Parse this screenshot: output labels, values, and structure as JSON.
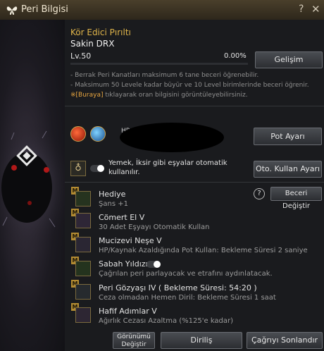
{
  "window": {
    "title": "Peri Bilgisi",
    "help_glyph": "?",
    "close_glyph": "✕"
  },
  "pet": {
    "name_line": "Kör Edici Pırıltı",
    "type_line": "Sakin DRX",
    "level": "Lv.50",
    "exp": "0.00%",
    "upgrade_button": "Gelişim"
  },
  "info": {
    "line1": "- Berrak Peri Kanatları maksimum 6 tane beceri öğrenebilir.",
    "line2": "- Maksimum 50 Levele kadar büyür ve 10 Level birimlerinde beceri öğrenir.",
    "line3_link": "[Buraya]",
    "line3_rest": " tıklayarak oran bilgisini görüntüleyebilirsiniz."
  },
  "potion": {
    "hp_label": "HP",
    "pot_button": "Pot Ayarı",
    "auto_use_text_1": "Yemek, İksir gibi eşyalar otomatik",
    "auto_use_text_2": "kullanılır.",
    "auto_use_button": "Oto. Kullan Ayarı"
  },
  "skills_header": {
    "change_button": "Beceri Değiştir"
  },
  "skills": [
    {
      "badge": "M",
      "name": "Hediye",
      "desc": "Şans +1",
      "icon": "clover-icon"
    },
    {
      "badge": "M",
      "name": "Cömert El V",
      "desc": "30 Adet Eşyayı Otomatik Kullan",
      "icon": "fairy-icon"
    },
    {
      "badge": "M",
      "name": "Mucizevi Neşe V",
      "desc": "HP/Kaynak Azaldığında Pot Kullan: Bekleme Süresi 2 saniye",
      "icon": "potion-icon"
    },
    {
      "badge": "M",
      "name": "Sabah Yıldızı",
      "desc": "Çağrılan peri parlayacak ve etrafını aydınlatacak.",
      "icon": "lantern-icon",
      "toggle": true
    },
    {
      "badge": "M",
      "name": "Peri Gözyaşı IV  ( Bekleme Süresi: 54:20 )",
      "desc": "Ceza olmadan Hemen Diril: Bekleme Süresi 1 saat",
      "icon": "tear-icon"
    },
    {
      "badge": "M",
      "name": "Hafif Adımlar V",
      "desc": "Ağırlık Cezası Azaltma (%125'e kadar)",
      "icon": "feather-icon"
    }
  ],
  "footer": {
    "appearance_line1": "Görünümü",
    "appearance_line2": "Değiştir",
    "revive_button": "Diriliş",
    "end_summon_button": "Çağrıyı Sonlandır"
  },
  "colors": {
    "accent_gold": "#e0b54a",
    "title_bar": "#3b3222",
    "link_orange": "#e8a640"
  }
}
